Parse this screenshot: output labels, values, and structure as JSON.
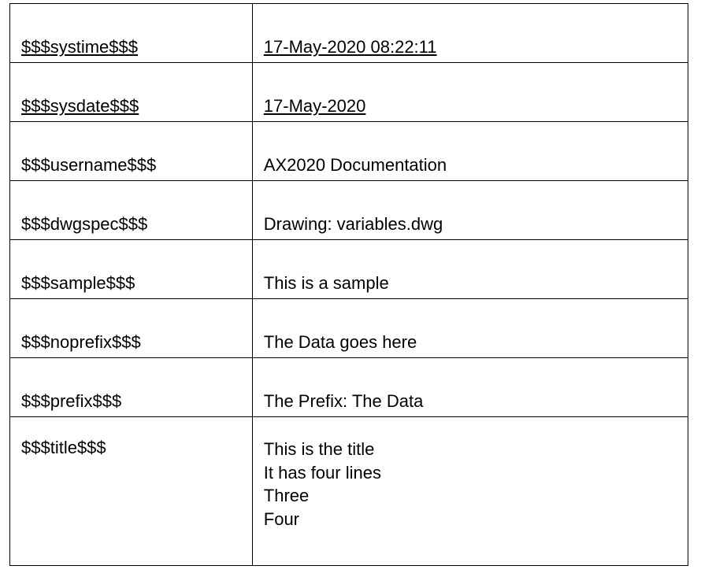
{
  "rows": [
    {
      "label": "$$$systime$$$",
      "value": "17-May-2020 08:22:11",
      "underline": true
    },
    {
      "label": "$$$sysdate$$$",
      "value": "17-May-2020",
      "underline": true
    },
    {
      "label": "$$$username$$$",
      "value": "AX2020 Documentation",
      "underline": false
    },
    {
      "label": "$$$dwgspec$$$",
      "value": "Drawing: variables.dwg",
      "underline": false
    },
    {
      "label": "$$$sample$$$",
      "value": "This is a sample",
      "underline": false
    },
    {
      "label": "$$$noprefix$$$",
      "value": "The Data goes here",
      "underline": false
    },
    {
      "label": "$$$prefix$$$",
      "value": "The Prefix: The Data",
      "underline": false
    }
  ],
  "title_row": {
    "label": "$$$title$$$",
    "lines": [
      "This is the title",
      "It has four lines",
      "Three",
      "Four"
    ]
  }
}
